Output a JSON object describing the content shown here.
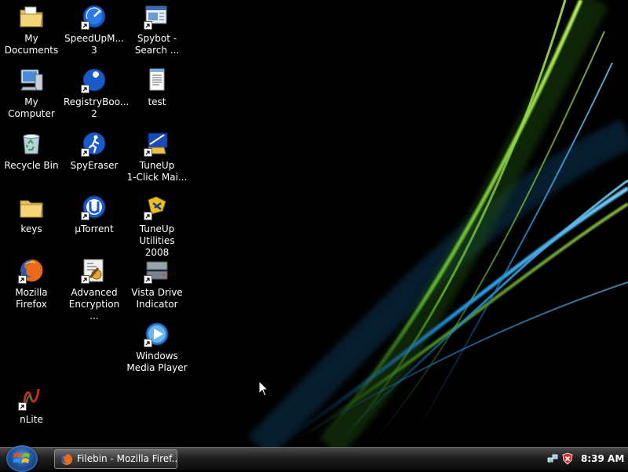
{
  "desktop": {
    "icons": [
      {
        "label": "My\nDocuments",
        "icon": "folder-documents-icon"
      },
      {
        "label": "My Computer",
        "icon": "computer-icon"
      },
      {
        "label": "Recycle Bin",
        "icon": "recycle-bin-icon"
      },
      {
        "label": "keys",
        "icon": "folder-icon"
      },
      {
        "label": "Mozilla Firefox",
        "icon": "firefox-icon"
      },
      {
        "label": "nLite",
        "icon": "nlite-icon"
      },
      {
        "label": "SpeedUpM...\n3",
        "icon": "speedometer-icon"
      },
      {
        "label": "RegistryBoo...\n2",
        "icon": "wrench-icon"
      },
      {
        "label": "SpyEraser",
        "icon": "running-man-icon"
      },
      {
        "label": "µTorrent",
        "icon": "utorrent-icon"
      },
      {
        "label": "Advanced\nEncryption ...",
        "icon": "encryption-icon"
      },
      {
        "label": "Spybot -\nSearch ...",
        "icon": "spybot-icon"
      },
      {
        "label": "test",
        "icon": "text-file-icon"
      },
      {
        "label": "TuneUp\n1-Click Mai...",
        "icon": "tuneup-1click-icon"
      },
      {
        "label": "TuneUp\nUtilities 2008",
        "icon": "tuneup-utilities-icon"
      },
      {
        "label": "Vista Drive\nIndicator",
        "icon": "drive-indicator-icon"
      },
      {
        "label": "Windows\nMedia Player",
        "icon": "media-player-icon"
      }
    ]
  },
  "taskbar": {
    "start_label": "",
    "tasks": [
      {
        "title": "Filebin - Mozilla Firef...",
        "icon": "firefox-icon"
      }
    ],
    "tray": {
      "icons": [
        "network-icon",
        "security-shield-icon"
      ],
      "clock": "8:39 AM"
    }
  },
  "colors": {
    "wallpaper_green": "#7fd63a",
    "wallpaper_blue": "#2a9ee0",
    "taskbar_top": "#4a4a4a",
    "taskbar_bottom": "#0a0a0a"
  }
}
